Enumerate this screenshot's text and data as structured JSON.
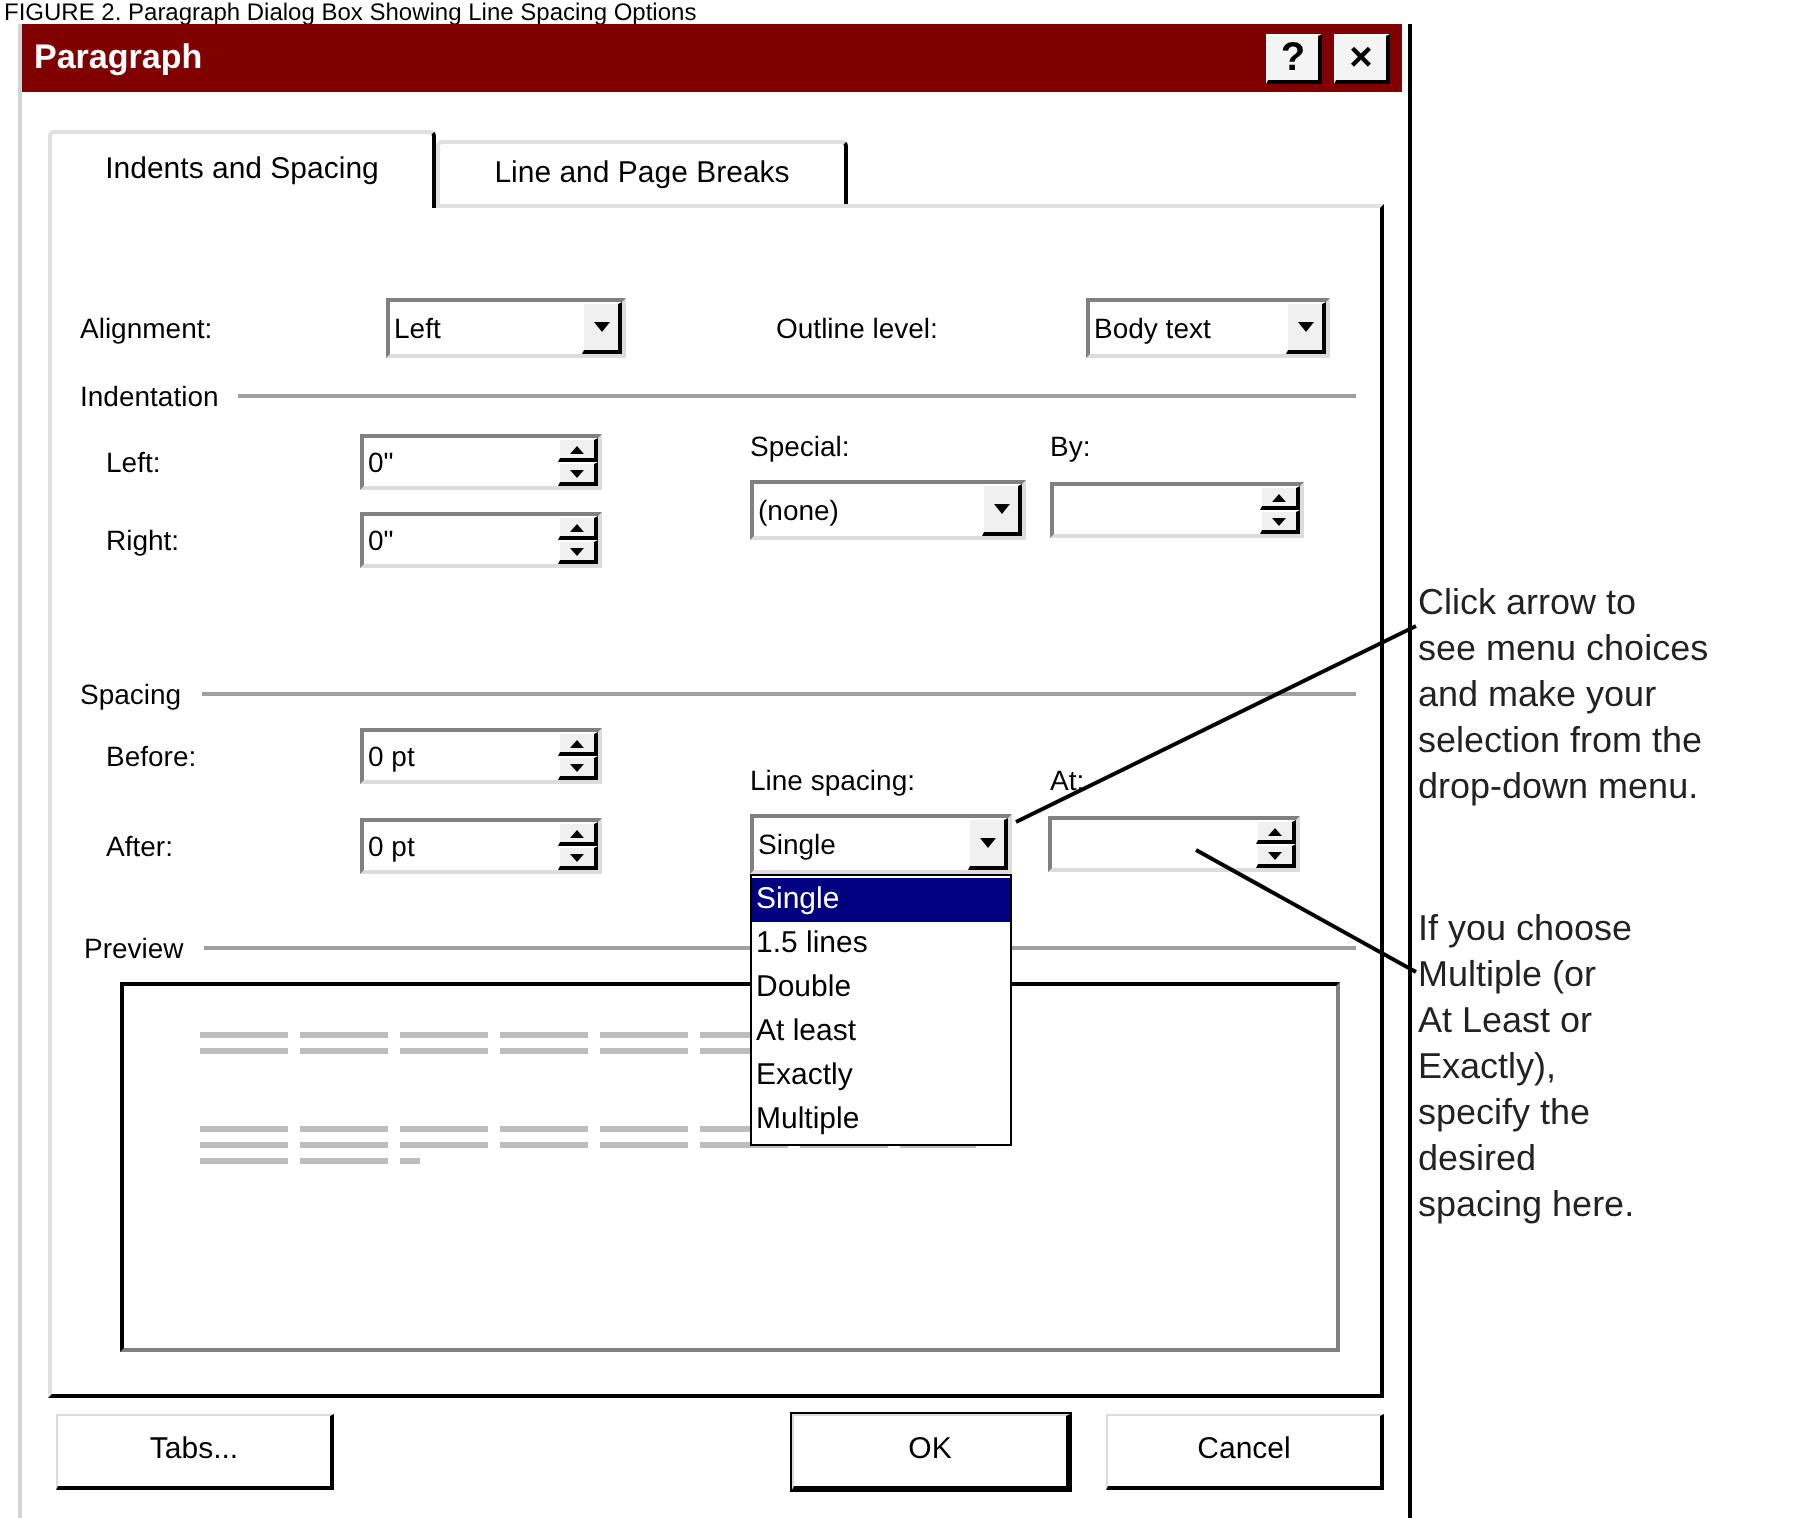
{
  "caption": "FIGURE 2. Paragraph Dialog Box Showing Line Spacing Options",
  "dialog": {
    "title": "Paragraph",
    "title_buttons": [
      "?",
      "×"
    ],
    "tabs": [
      {
        "label": "Indents and Spacing",
        "selected": true
      },
      {
        "label": "Line and Page Breaks",
        "selected": false
      }
    ],
    "alignment": {
      "label": "Alignment:",
      "value": "Left"
    },
    "outline_level": {
      "label": "Outline level:",
      "value": "Body text"
    },
    "indentation": {
      "title": "Indentation",
      "left": {
        "label": "Left:",
        "value": "0\""
      },
      "right": {
        "label": "Right:",
        "value": "0\""
      },
      "special": {
        "label": "Special:",
        "value": "(none)"
      },
      "by": {
        "label": "By:"
      }
    },
    "spacing": {
      "title": "Spacing",
      "before": {
        "label": "Before:",
        "value": "0 pt"
      },
      "after": {
        "label": "After:",
        "value": "0 pt"
      },
      "line_spacing": {
        "label": "Line spacing:",
        "value": "Single",
        "expanded": true,
        "options": [
          {
            "label": "Single",
            "selected": true
          },
          {
            "label": "1.5 lines",
            "selected": false
          },
          {
            "label": "Double",
            "selected": false
          },
          {
            "label": "At least",
            "selected": false
          },
          {
            "label": "Exactly",
            "selected": false
          },
          {
            "label": "Multiple",
            "selected": false
          }
        ]
      },
      "at": {
        "label": "At:"
      }
    },
    "preview": {
      "title": "Preview"
    },
    "buttons": [
      {
        "label": "Tabs...",
        "default": false
      },
      {
        "label": "OK",
        "default": true
      },
      {
        "label": "Cancel",
        "default": false
      }
    ]
  },
  "annotations": [
    {
      "text": "Click arrow to\nsee menu choices\nand make your\nselection from the\ndrop-down menu."
    },
    {
      "text": "If you choose\nMultiple (or\nAt Least or\nExactly),\nspecify the\ndesired\nspacing here."
    }
  ]
}
